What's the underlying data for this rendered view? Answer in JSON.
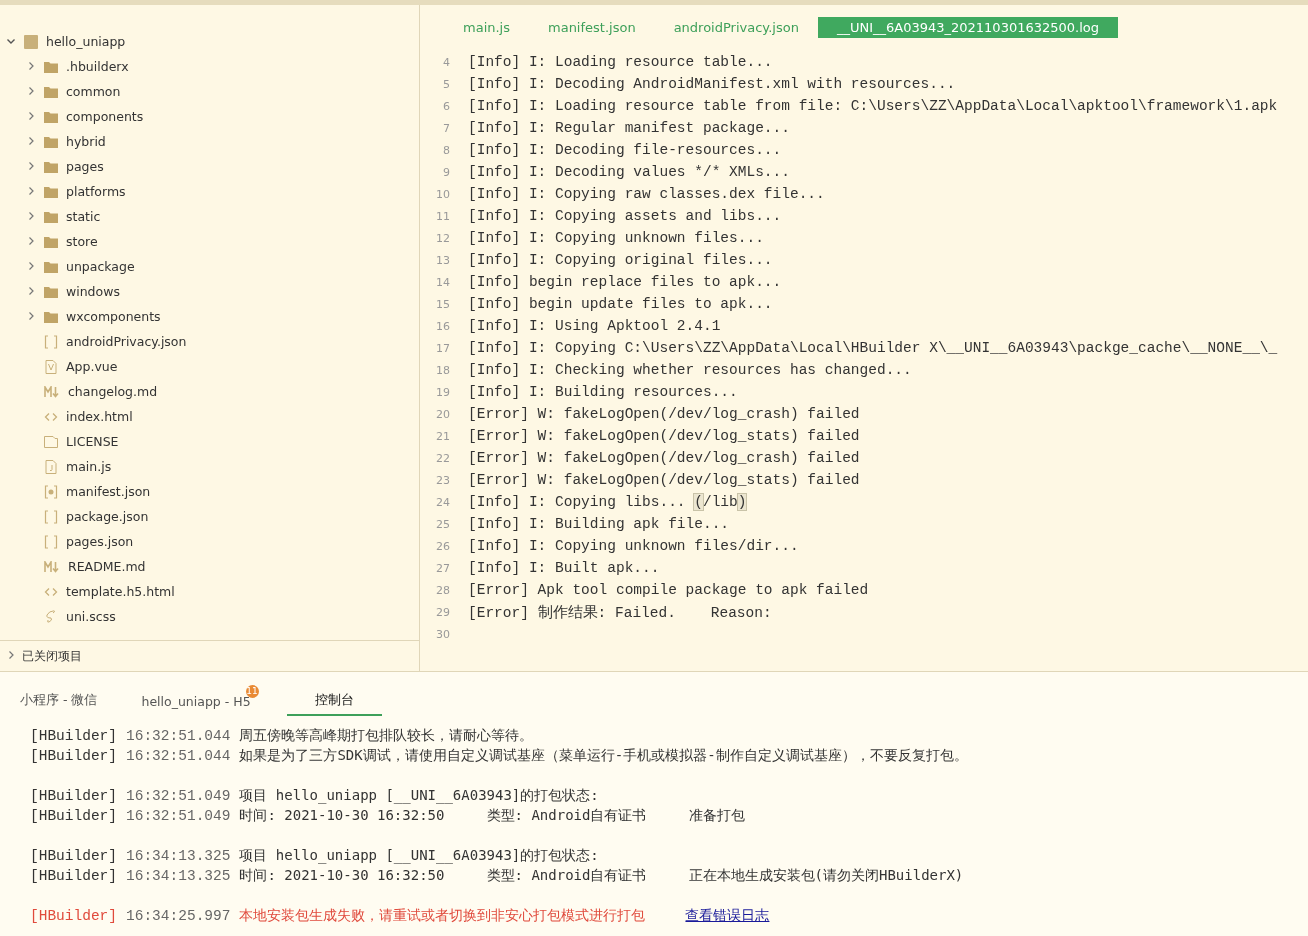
{
  "sidebar": {
    "project": {
      "name": "hello_uniapp",
      "expanded": true,
      "children": [
        {
          "name": ".hbuilderx",
          "kind": "folder",
          "expanded": false
        },
        {
          "name": "common",
          "kind": "folder",
          "expanded": false
        },
        {
          "name": "components",
          "kind": "folder",
          "expanded": false
        },
        {
          "name": "hybrid",
          "kind": "folder",
          "expanded": false
        },
        {
          "name": "pages",
          "kind": "folder",
          "expanded": false
        },
        {
          "name": "platforms",
          "kind": "folder",
          "expanded": false
        },
        {
          "name": "static",
          "kind": "folder",
          "expanded": false
        },
        {
          "name": "store",
          "kind": "folder",
          "expanded": false
        },
        {
          "name": "unpackage",
          "kind": "folder",
          "expanded": false
        },
        {
          "name": "windows",
          "kind": "folder",
          "expanded": false
        },
        {
          "name": "wxcomponents",
          "kind": "folder",
          "expanded": false
        },
        {
          "name": "androidPrivacy.json",
          "kind": "json"
        },
        {
          "name": "App.vue",
          "kind": "vue"
        },
        {
          "name": "changelog.md",
          "kind": "markdown"
        },
        {
          "name": "index.html",
          "kind": "html"
        },
        {
          "name": "LICENSE",
          "kind": "plain"
        },
        {
          "name": "main.js",
          "kind": "js"
        },
        {
          "name": "manifest.json",
          "kind": "config"
        },
        {
          "name": "package.json",
          "kind": "json"
        },
        {
          "name": "pages.json",
          "kind": "json"
        },
        {
          "name": "README.md",
          "kind": "markdown"
        },
        {
          "name": "template.h5.html",
          "kind": "html"
        },
        {
          "name": "uni.scss",
          "kind": "sass"
        }
      ]
    },
    "closed_projects": {
      "label": "已关闭项目",
      "expanded": false
    }
  },
  "editor": {
    "tabs": [
      {
        "label": "main.js",
        "selected": false
      },
      {
        "label": "manifest.json",
        "selected": false
      },
      {
        "label": "androidPrivacy.json",
        "selected": false
      },
      {
        "label": "__UNI__6A03943_202110301632500.log",
        "selected": true
      }
    ],
    "lines": [
      {
        "number": "4",
        "text": "[Info] I: Loading resource table..."
      },
      {
        "number": "5",
        "text": "[Info] I: Decoding AndroidManifest.xml with resources..."
      },
      {
        "number": "6",
        "text": "[Info] I: Loading resource table from file: C:\\Users\\ZZ\\AppData\\Local\\apktool\\framework\\1.apk"
      },
      {
        "number": "7",
        "text": "[Info] I: Regular manifest package..."
      },
      {
        "number": "8",
        "text": "[Info] I: Decoding file-resources..."
      },
      {
        "number": "9",
        "text": "[Info] I: Decoding values */* XMLs..."
      },
      {
        "number": "10",
        "text": "[Info] I: Copying raw classes.dex file..."
      },
      {
        "number": "11",
        "text": "[Info] I: Copying assets and libs..."
      },
      {
        "number": "12",
        "text": "[Info] I: Copying unknown files..."
      },
      {
        "number": "13",
        "text": "[Info] I: Copying original files..."
      },
      {
        "number": "14",
        "text": "[Info] begin replace files to apk..."
      },
      {
        "number": "15",
        "text": "[Info] begin update files to apk..."
      },
      {
        "number": "16",
        "text": "[Info] I: Using Apktool 2.4.1"
      },
      {
        "number": "17",
        "text": "[Info] I: Copying C:\\Users\\ZZ\\AppData\\Local\\HBuilder X\\__UNI__6A03943\\packge_cache\\__NONE__\\_"
      },
      {
        "number": "18",
        "text": "[Info] I: Checking whether resources has changed..."
      },
      {
        "number": "19",
        "text": "[Info] I: Building resources..."
      },
      {
        "number": "20",
        "text": "[Error] W: fakeLogOpen(/dev/log_crash) failed"
      },
      {
        "number": "21",
        "text": "[Error] W: fakeLogOpen(/dev/log_stats) failed"
      },
      {
        "number": "22",
        "text": "[Error] W: fakeLogOpen(/dev/log_crash) failed"
      },
      {
        "number": "23",
        "text": "[Error] W: fakeLogOpen(/dev/log_stats) failed"
      },
      {
        "number": "24",
        "segments": [
          {
            "text": "[Info] I: Copying libs... ",
            "highlighted": false
          },
          {
            "text": "(",
            "highlighted": true
          },
          {
            "text": "/lib",
            "highlighted": false
          },
          {
            "text": ")",
            "highlighted": true
          }
        ]
      },
      {
        "number": "25",
        "text": "[Info] I: Building apk file..."
      },
      {
        "number": "26",
        "text": "[Info] I: Copying unknown files/dir..."
      },
      {
        "number": "27",
        "text": "[Info] I: Built apk..."
      },
      {
        "number": "28",
        "text": "[Error] Apk tool compile package to apk failed"
      },
      {
        "number": "29",
        "text": "[Error] 制作结果: Failed.    Reason:"
      },
      {
        "number": "30"
      }
    ]
  },
  "console": {
    "tabs": [
      {
        "label": "小程序 - 微信",
        "selected": false
      },
      {
        "label": "hello_uniapp - H5",
        "selected": false,
        "badge": "11"
      },
      {
        "label": "控制台",
        "selected": true
      }
    ],
    "groups": [
      [
        {
          "source": "[HBuilder]",
          "time": "16:32:51.044",
          "message": "周五傍晚等高峰期打包排队较长，请耐心等待。",
          "kind": "normal"
        },
        {
          "source": "[HBuilder]",
          "time": "16:32:51.044",
          "message": "如果是为了三方SDK调试，请使用自定义调试基座（菜单运行-手机或模拟器-制作自定义调试基座），不要反复打包。",
          "kind": "normal"
        }
      ],
      [
        {
          "source": "[HBuilder]",
          "time": "16:32:51.049",
          "message": "项目 hello_uniapp [__UNI__6A03943]的打包状态:",
          "kind": "normal"
        },
        {
          "source": "[HBuilder]",
          "time": "16:32:51.049",
          "message": "时间: 2021-10-30 16:32:50     类型: Android自有证书     准备打包",
          "kind": "normal"
        }
      ],
      [
        {
          "source": "[HBuilder]",
          "time": "16:34:13.325",
          "message": "项目 hello_uniapp [__UNI__6A03943]的打包状态:",
          "kind": "normal"
        },
        {
          "source": "[HBuilder]",
          "time": "16:34:13.325",
          "message": "时间: 2021-10-30 16:32:50     类型: Android自有证书     正在本地生成安装包(请勿关闭HBuilderX)",
          "kind": "normal"
        }
      ],
      [
        {
          "source": "[HBuilder]",
          "time": "16:34:25.997",
          "message": "本地安装包生成失败，请重试或者切换到非安心打包模式进行打包",
          "kind": "error",
          "link": "查看错误日志"
        }
      ]
    ]
  }
}
